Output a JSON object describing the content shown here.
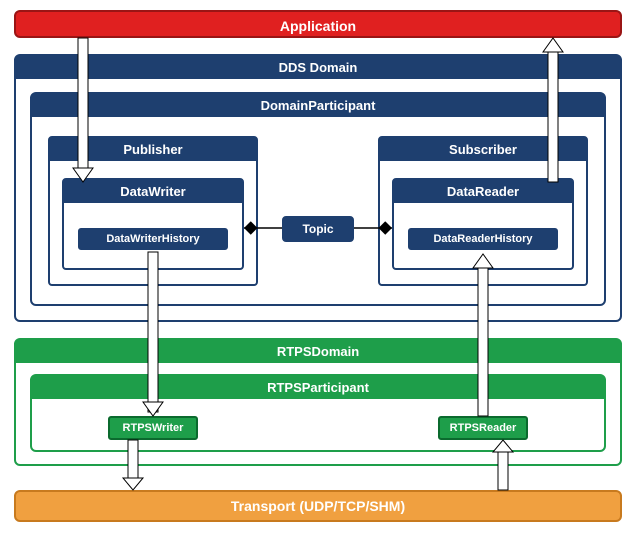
{
  "application": {
    "label": "Application"
  },
  "dds_domain": {
    "label": "DDS Domain",
    "participant": {
      "label": "DomainParticipant",
      "publisher": {
        "label": "Publisher",
        "writer": {
          "label": "DataWriter",
          "history": "DataWriterHistory"
        }
      },
      "subscriber": {
        "label": "Subscriber",
        "reader": {
          "label": "DataReader",
          "history": "DataReaderHistory"
        }
      },
      "topic": {
        "label": "Topic"
      }
    }
  },
  "rtps_domain": {
    "label": "RTPSDomain",
    "participant": {
      "label": "RTPSParticipant",
      "writer": "RTPSWriter",
      "reader": "RTPSReader"
    }
  },
  "transport": {
    "label": "Transport (UDP/TCP/SHM)"
  }
}
